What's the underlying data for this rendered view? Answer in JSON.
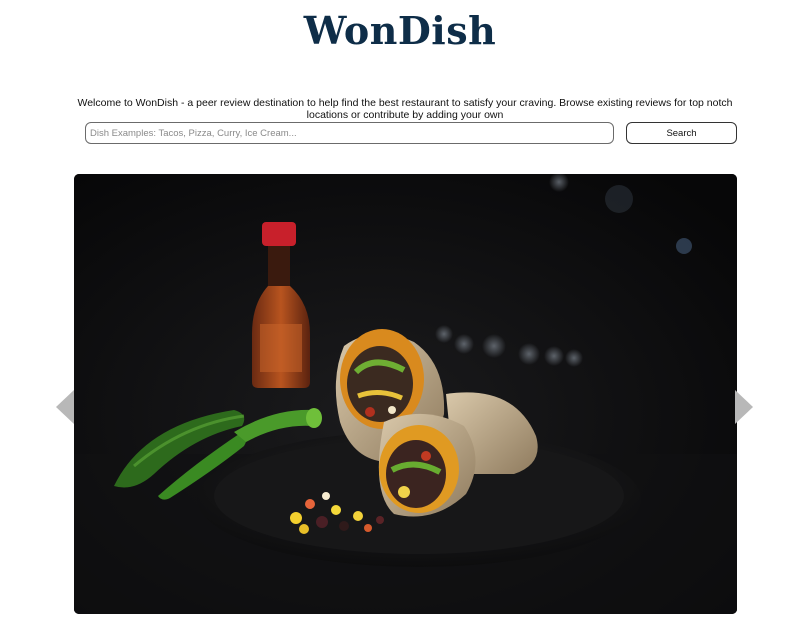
{
  "header": {
    "brand": "WonDish"
  },
  "intro": {
    "text": "Welcome to WonDish - a peer review destination to help find the best restaurant to satisfy your craving. Browse existing reviews for top notch locations or contribute by adding your own"
  },
  "search": {
    "placeholder": "Dish Examples: Tacos, Pizza, Curry, Ice Cream...",
    "value": "",
    "button_label": "Search"
  },
  "carousel": {
    "image_alt": "burrito with hot sauce and peppers",
    "prev_icon": "chevron-left-icon",
    "next_icon": "chevron-right-icon"
  },
  "colors": {
    "brand": "#0e2d48",
    "arrow": "#b8b8b8",
    "photo_background": "#0b0b0c"
  }
}
